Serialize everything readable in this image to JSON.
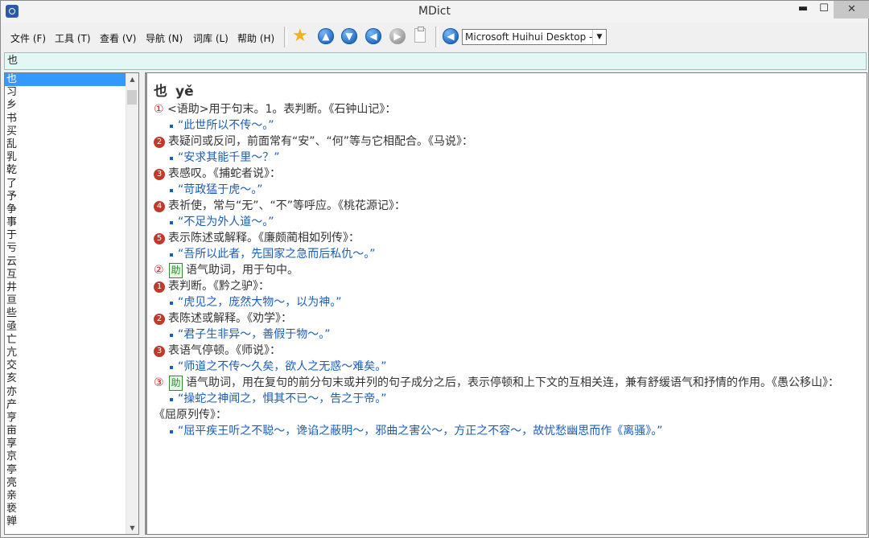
{
  "window": {
    "title": "MDict",
    "min": "▬",
    "max": "☐",
    "close": "✕"
  },
  "menu": [
    {
      "key": "file",
      "label": "文件 (F)"
    },
    {
      "key": "tools",
      "label": "工具 (T)"
    },
    {
      "key": "view",
      "label": "查看 (V)"
    },
    {
      "key": "nav",
      "label": "导航 (N)"
    },
    {
      "key": "library",
      "label": "词库 (L)"
    },
    {
      "key": "help",
      "label": "帮助 (H)"
    }
  ],
  "toolbar": {
    "voice": "Microsoft Huihui Desktop - C",
    "icons": [
      "favorite-star-icon",
      "up-icon",
      "down-icon",
      "back-icon",
      "forward-icon",
      "clipboard-icon",
      "speak-icon"
    ]
  },
  "search": {
    "value": "也"
  },
  "wordlist": [
    "也",
    "习",
    "乡",
    "书",
    "买",
    "乱",
    "乳",
    "乾",
    "了",
    "予",
    "争",
    "事",
    "于",
    "亏",
    "云",
    "互",
    "井",
    "亘",
    "些",
    "亟",
    "亡",
    "亢",
    "交",
    "亥",
    "亦",
    "产",
    "亨",
    "亩",
    "享",
    "京",
    "亭",
    "亮",
    "亲",
    "亵",
    "亸"
  ],
  "entry": {
    "headword": "也",
    "pinyin": "yě",
    "s1": {
      "num": "①",
      "text": "<语助>用于句末。1。表判断。《石钟山记》："
    },
    "s1_ex": "“此世所以不传～。”",
    "s1_2": {
      "num": "2",
      "text": "表疑问或反问，前面常有“安”、“何”等与它相配合。《马说》："
    },
    "s1_2_ex": "“安求其能千里～？”",
    "s1_3": {
      "num": "3",
      "text": "表感叹。《捕蛇者说》："
    },
    "s1_3_ex": "“苛政猛于虎～。”",
    "s1_4": {
      "num": "4",
      "text": "表祈使，常与“无”、“不”等呼应。《桃花源记》："
    },
    "s1_4_ex": "“不足为外人道～。”",
    "s1_5": {
      "num": "5",
      "text": "表示陈述或解释。《廉颇蔺相如列传》："
    },
    "s1_5_ex": "“吾所以此者，先国家之急而后私仇～。”",
    "s2": {
      "num": "②",
      "pos": "助",
      "text": "语气助词，用于句中。"
    },
    "s2_1": {
      "num": "1",
      "text": "表判断。《黔之驴》："
    },
    "s2_1_ex": "“虎见之，庞然大物～，以为神。”",
    "s2_2": {
      "num": "2",
      "text": "表陈述或解释。《劝学》："
    },
    "s2_2_ex": "“君子生非异～，善假于物～。”",
    "s2_3": {
      "num": "3",
      "text": "表语气停顿。《师说》："
    },
    "s2_3_ex": "“师道之不传～久矣，欲人之无惑～难矣。”",
    "s3": {
      "num": "③",
      "pos": "助",
      "text": "语气助词，用在复句的前分句末或并列的句子成分之后，表示停顿和上下文的互相关连，兼有舒缓语气和抒情的作用。《愚公移山》："
    },
    "s3_ex": "“操蛇之神闻之，惧其不已～，告之于帝。”",
    "s3_src": "《屈原列传》：",
    "s3_ex2": "“屈平疾王听之不聪～，谗谄之蔽明～，邪曲之害公～，方正之不容～，故忧愁幽思而作《离骚》。”"
  }
}
